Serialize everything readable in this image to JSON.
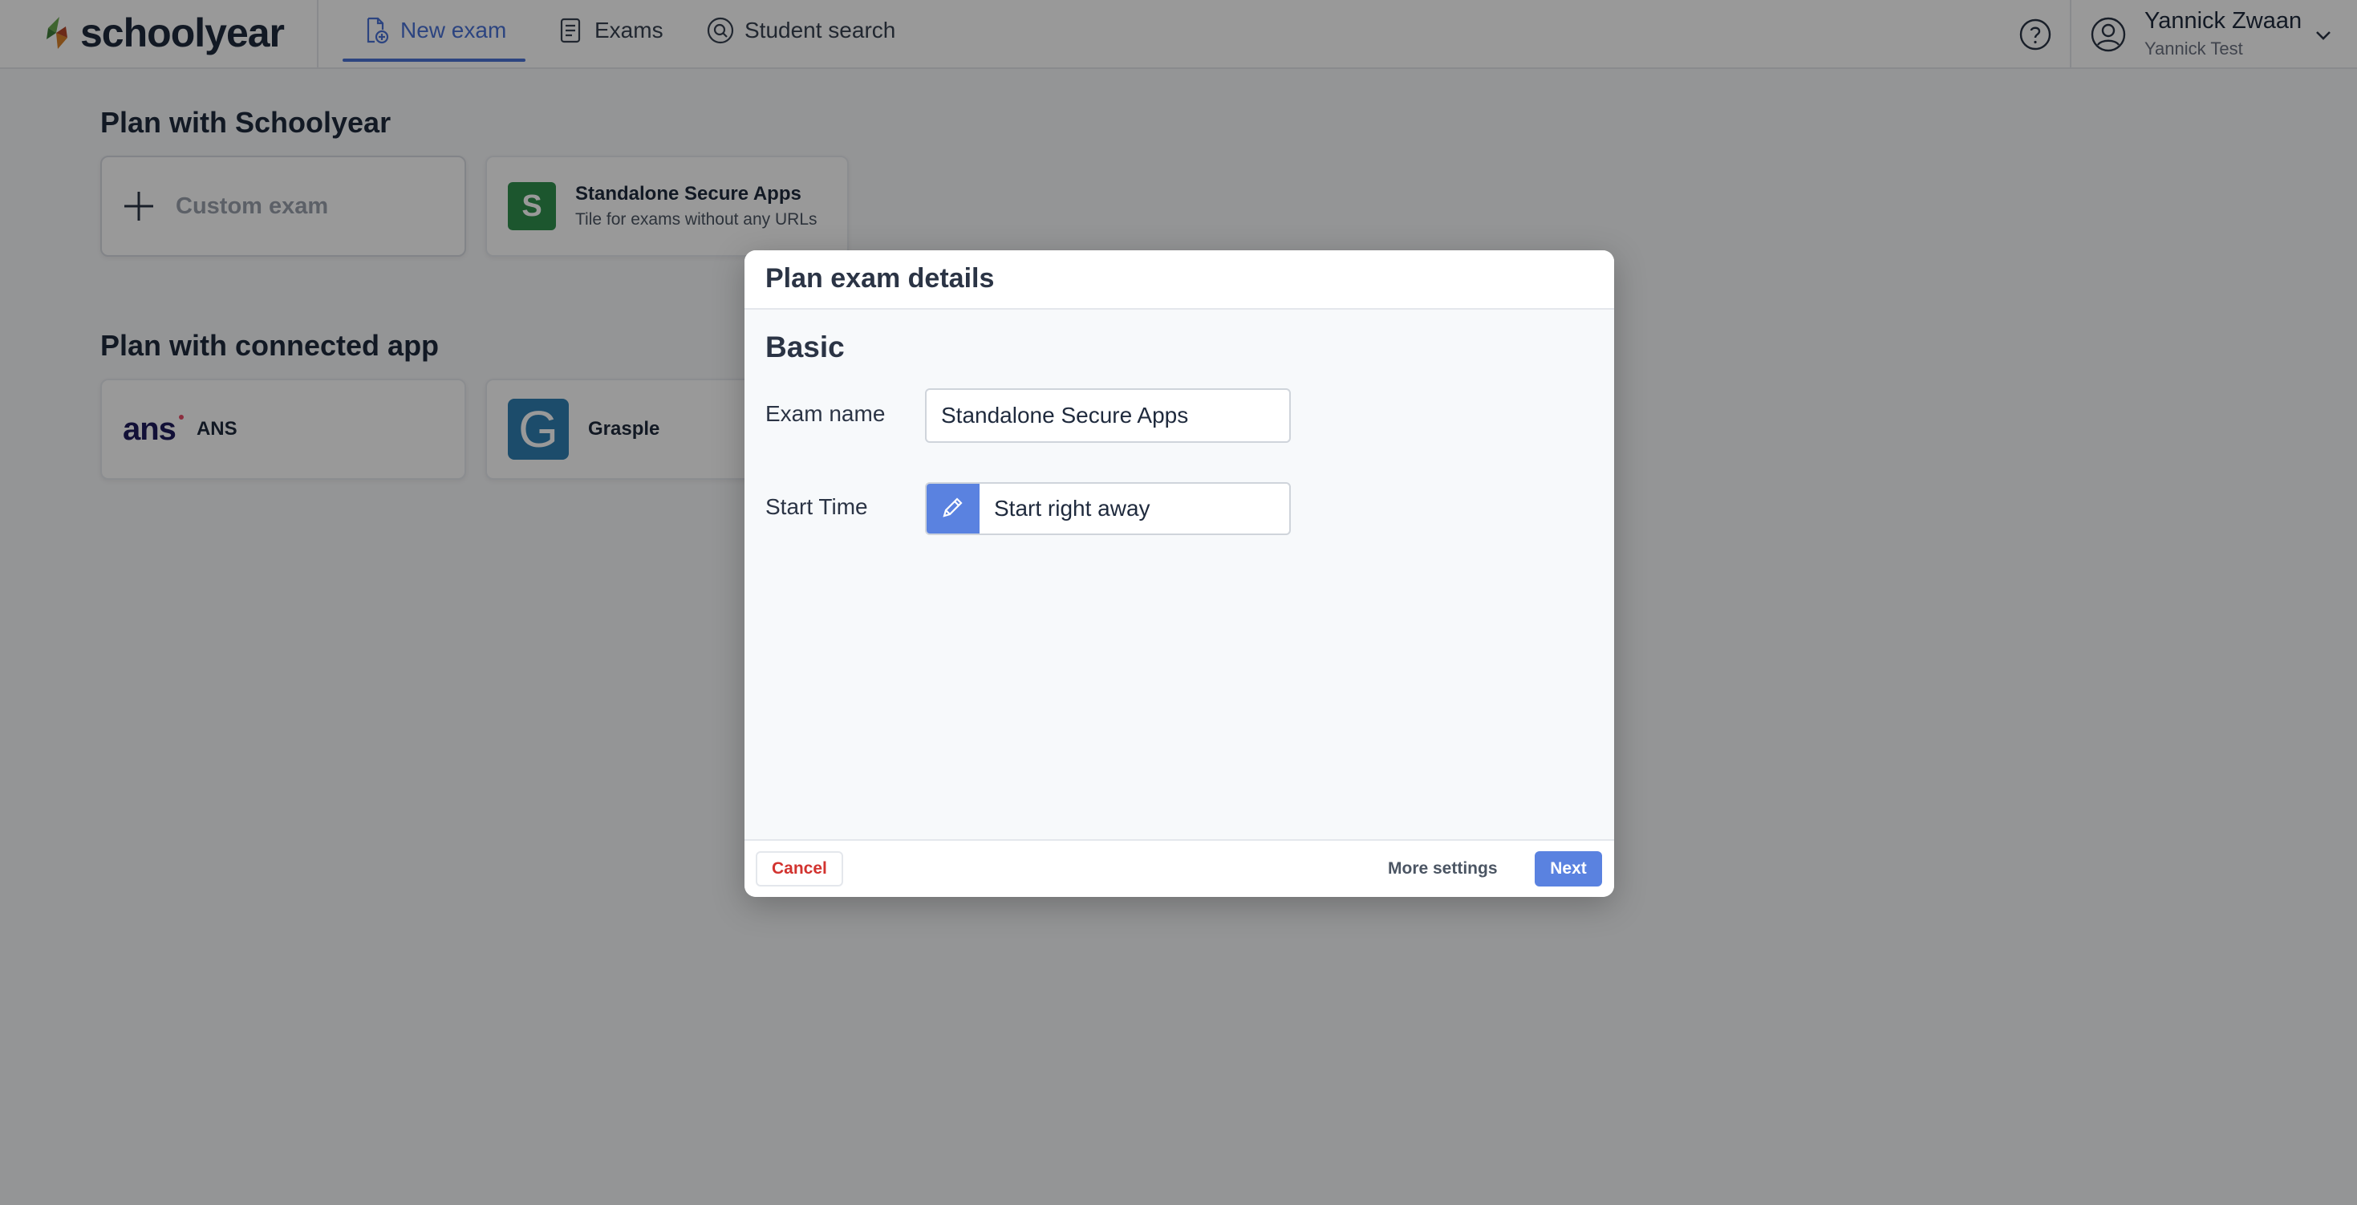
{
  "brand": {
    "name": "schoolyear"
  },
  "nav": {
    "tabs": [
      {
        "label": "New exam",
        "icon": "new-exam-icon",
        "active": true
      },
      {
        "label": "Exams",
        "icon": "exams-icon",
        "active": false
      },
      {
        "label": "Student search",
        "icon": "student-search-icon",
        "active": false
      }
    ]
  },
  "user": {
    "name": "Yannick Zwaan",
    "organization": "Yannick Test"
  },
  "sections": {
    "schoolyear_title": "Plan with Schoolyear",
    "connected_title": "Plan with connected app"
  },
  "tiles": {
    "custom": {
      "label": "Custom exam"
    },
    "standalone": {
      "badge": "S",
      "title": "Standalone Secure Apps",
      "subtitle": "Tile for exams without any URLs",
      "color": "#2f8f4e"
    },
    "ans": {
      "logo": "ans",
      "label": "ANS"
    },
    "grasple": {
      "badge": "G",
      "label": "Grasple",
      "color": "#2f7fb3"
    }
  },
  "modal": {
    "title": "Plan exam details",
    "section": "Basic",
    "exam_name_label": "Exam name",
    "exam_name_value": "Standalone Secure Apps",
    "start_time_label": "Start Time",
    "start_time_value": "Start right away",
    "cancel_label": "Cancel",
    "more_settings_label": "More settings",
    "next_label": "Next"
  },
  "colors": {
    "accent": "#5a82e0",
    "danger": "#d2332f",
    "overlay": "rgba(0,0,0,0.40)"
  }
}
